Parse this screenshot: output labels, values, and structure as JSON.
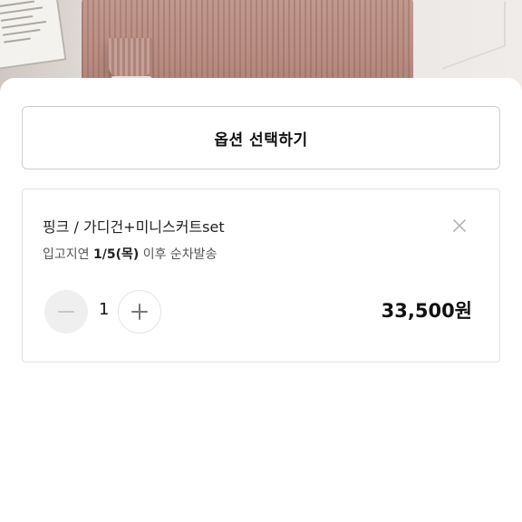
{
  "option_button": {
    "label": "옵션 선택하기"
  },
  "item": {
    "name": "핑크 / 가디건+미니스커트set",
    "note_prefix": "입고지연 ",
    "note_date": "1/5(목)",
    "note_suffix": " 이후 순차발송",
    "quantity": "1",
    "price": "33,500원"
  },
  "icons": {
    "remove": "close-icon",
    "decrease": "minus-icon",
    "increase": "plus-icon"
  },
  "colors": {
    "minus_button_bg": "#efefef",
    "border": "#cfcfcf"
  }
}
